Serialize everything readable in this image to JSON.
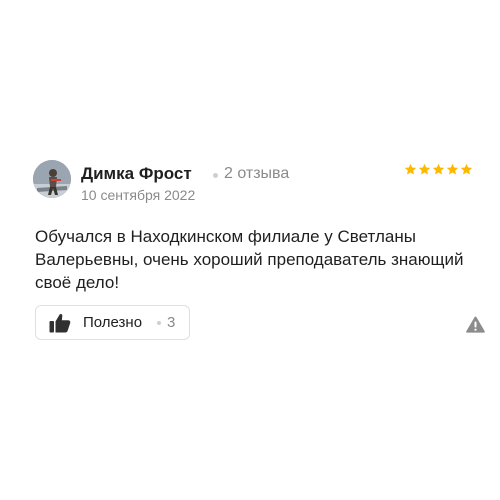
{
  "review": {
    "author": {
      "name": "Димка Фрост",
      "reviews_count": "2 отзыва",
      "avatar_icon": "user-photo"
    },
    "date": "10 сентября 2022",
    "rating": 5,
    "rating_max": 5,
    "star_color": "#ffb800",
    "text": "Обучался в Находкинском филиале у Светланы Валерьевны, очень хороший преподаватель знающий своё дело!",
    "helpful": {
      "label": "Полезно",
      "count": "3",
      "icon": "thumbs-up-icon"
    },
    "report": {
      "icon": "warning-icon"
    }
  }
}
